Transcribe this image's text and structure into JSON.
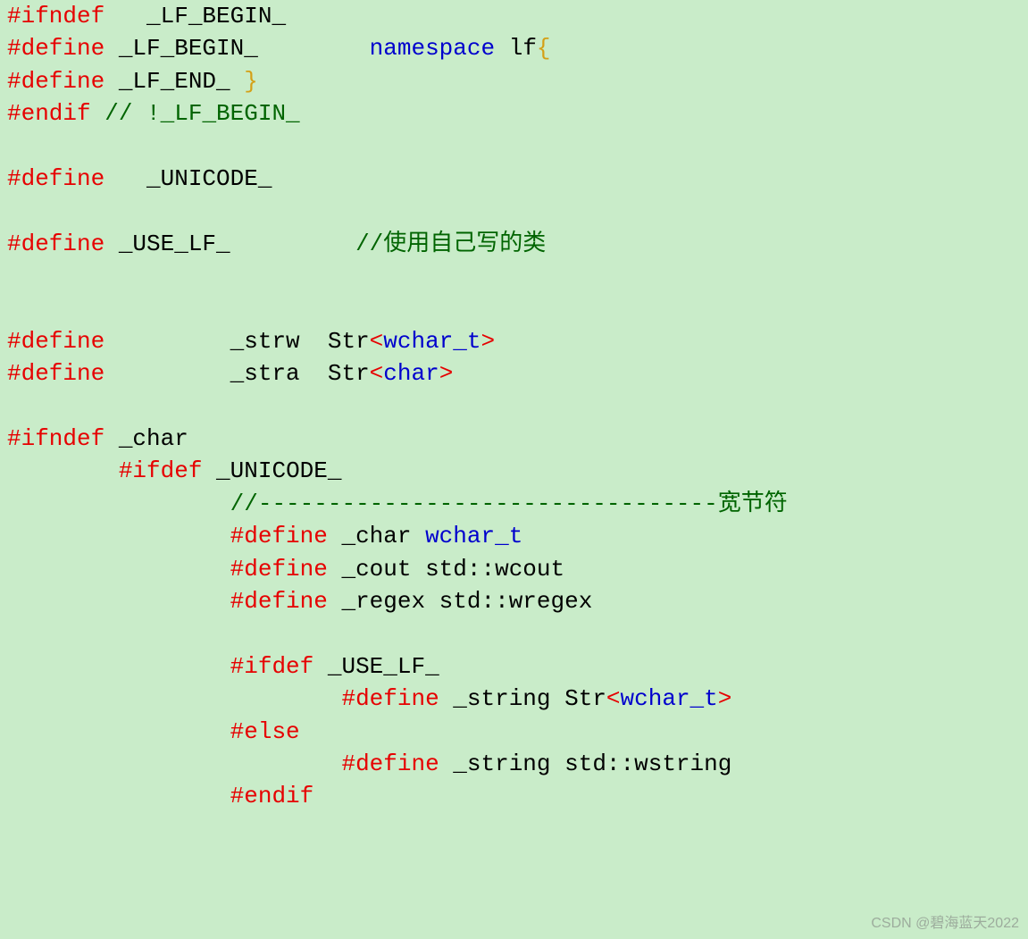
{
  "code": {
    "l1": {
      "kw": "#ifndef",
      "txt": "   _LF_BEGIN_"
    },
    "l2": {
      "kw": "#define",
      "txt1": " _LF_BEGIN_        ",
      "ns": "namespace",
      "txt2": " lf",
      "br": "{"
    },
    "l3": {
      "kw": "#define",
      "txt": " _LF_END_ ",
      "br": "}"
    },
    "l4": {
      "kw": "#endif",
      "cm": " // !_LF_BEGIN_"
    },
    "l6": {
      "kw": "#define",
      "txt": "   _UNICODE_"
    },
    "l8": {
      "kw": "#define",
      "txt": " _USE_LF_         ",
      "cm": "//使用自己写的类"
    },
    "l11": {
      "kw": "#define",
      "txt1": "         _strw  Str",
      "op1": "<",
      "tp": "wchar_t",
      "op2": ">"
    },
    "l12": {
      "kw": "#define",
      "txt1": "         _stra  Str",
      "op1": "<",
      "tp": "char",
      "op2": ">"
    },
    "l14": {
      "kw": "#ifndef",
      "txt": " _char"
    },
    "l15": {
      "indent": "        ",
      "kw": "#ifdef",
      "txt": " _UNICODE_"
    },
    "l16": {
      "indent": "                ",
      "cm": "//---------------------------------宽节符"
    },
    "l17": {
      "indent": "                ",
      "kw": "#define",
      "txt1": " _char ",
      "tp": "wchar_t"
    },
    "l18": {
      "indent": "                ",
      "kw": "#define",
      "txt": " _cout std::wcout"
    },
    "l19": {
      "indent": "                ",
      "kw": "#define",
      "txt": " _regex std::wregex"
    },
    "l21": {
      "indent": "                ",
      "kw": "#ifdef",
      "txt": " _USE_LF_"
    },
    "l22": {
      "indent": "                        ",
      "kw": "#define",
      "txt1": " _string Str",
      "op1": "<",
      "tp": "wchar_t",
      "op2": ">"
    },
    "l23": {
      "indent": "                ",
      "kw": "#else"
    },
    "l24": {
      "indent": "                        ",
      "kw": "#define",
      "txt": " _string std::wstring"
    },
    "l25": {
      "indent": "                ",
      "kw": "#endif"
    }
  },
  "watermark": "CSDN @碧海蓝天2022"
}
